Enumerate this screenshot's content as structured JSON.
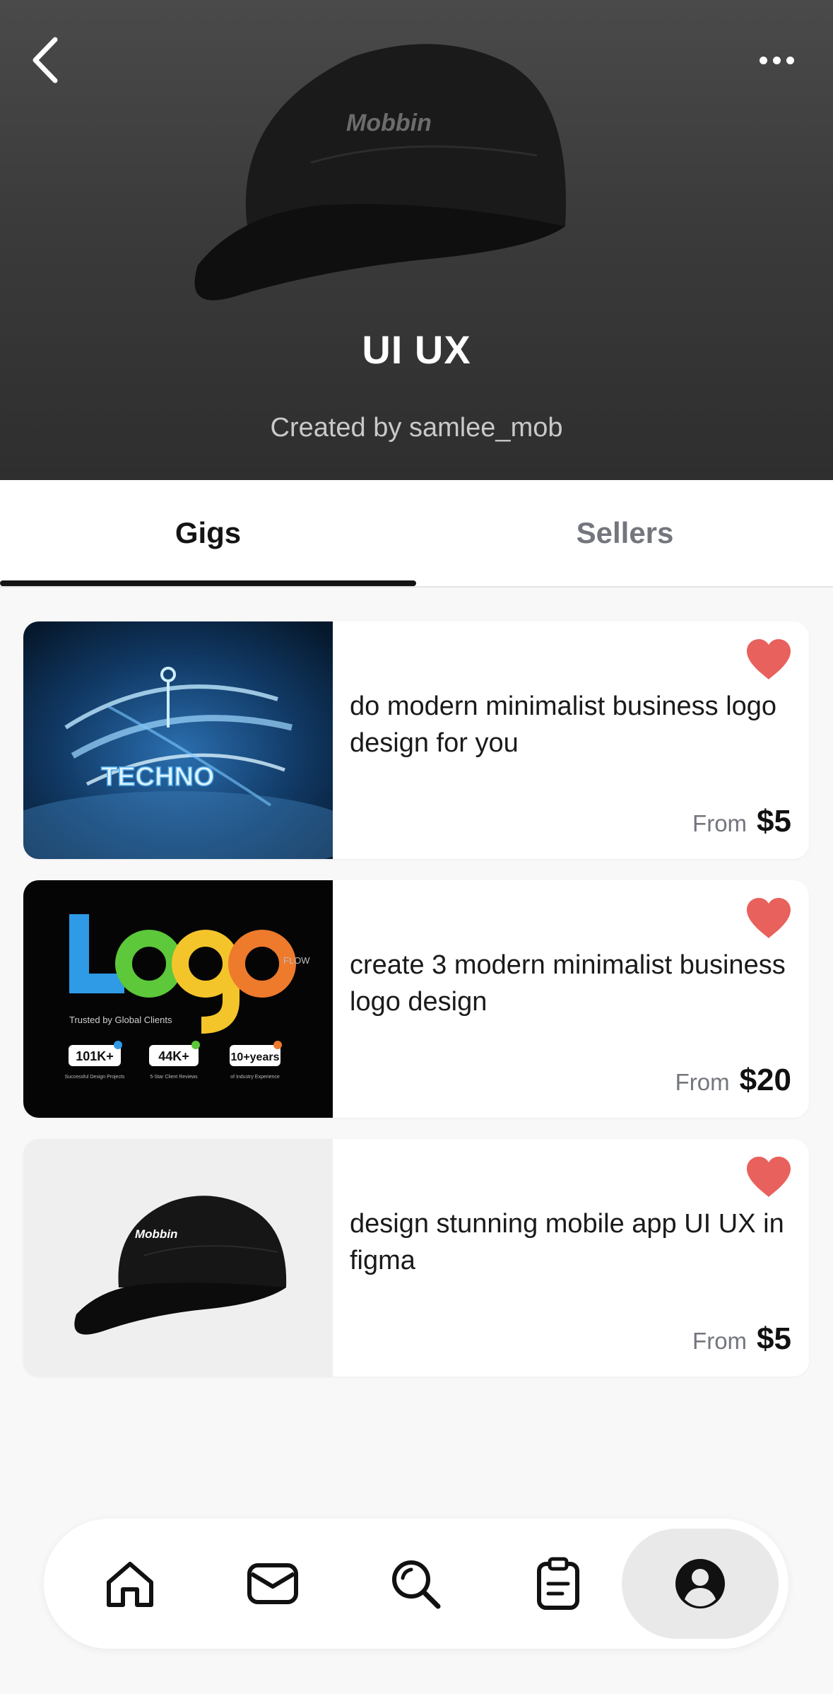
{
  "header": {
    "title": "UI UX",
    "created_by": "Created by samlee_mob",
    "brand_text": "Mobbin",
    "back_icon": "chevron-left-icon",
    "more_icon": "more-horizontal-icon"
  },
  "tabs": [
    {
      "label": "Gigs",
      "active": true
    },
    {
      "label": "Sellers",
      "active": false
    }
  ],
  "gigs": [
    {
      "title": "do modern minimalist business logo design for you",
      "price_prefix": "From",
      "price": "$5",
      "favorited": true,
      "thumb_text": "TECHNO"
    },
    {
      "title": "create 3 modern minimalist business logo design",
      "price_prefix": "From",
      "price": "$20",
      "favorited": true,
      "thumb_logo": "Logo",
      "thumb_brand": "FLOW",
      "thumb_tagline": "Trusted by Global Clients",
      "thumb_stats": [
        {
          "value": "101K+",
          "label": "Successful Design Projects"
        },
        {
          "value": "44K+",
          "label": "5-Star Client Reviews"
        },
        {
          "value": "10+years",
          "label": "of Industry Experience"
        }
      ]
    },
    {
      "title": "design stunning mobile app UI UX in figma",
      "price_prefix": "From",
      "price": "$5",
      "favorited": true,
      "thumb_text": "Mobbin"
    }
  ],
  "bottom_nav": [
    {
      "icon": "home-icon",
      "active": false
    },
    {
      "icon": "inbox-icon",
      "active": false
    },
    {
      "icon": "search-icon",
      "active": false
    },
    {
      "icon": "orders-clipboard-icon",
      "active": false
    },
    {
      "icon": "profile-icon",
      "active": true
    }
  ],
  "colors": {
    "heart": "#e8615c",
    "tab_active": "#141414",
    "tab_inactive": "#74767e",
    "header_bg": "#3b3b3b"
  }
}
